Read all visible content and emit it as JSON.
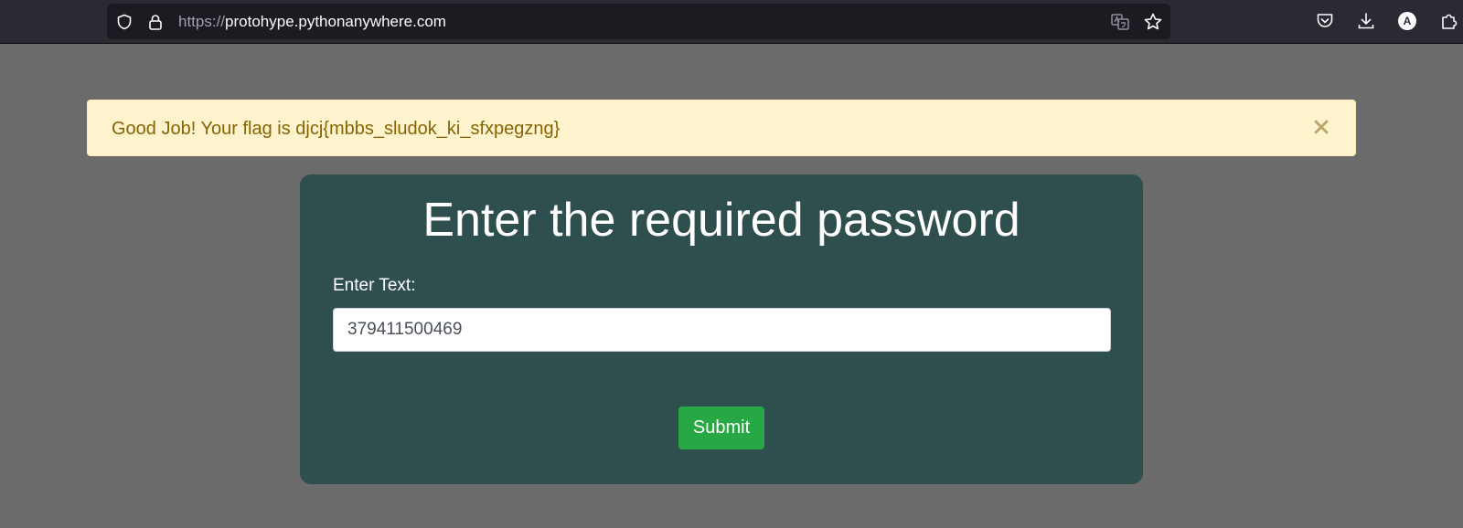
{
  "browser": {
    "url_scheme": "https://",
    "url_host": "protohype.pythonanywhere.com",
    "profile_initial": "A",
    "icons": [
      "shield-icon",
      "lock-icon",
      "translate-icon",
      "bookmark-star-icon",
      "pocket-icon",
      "download-icon",
      "extensions-icon"
    ]
  },
  "alert": {
    "message": "Good Job! Your flag is djcj{mbbs_sludok_ki_sfxpegzng}",
    "close_icon": "close-icon"
  },
  "form": {
    "title": "Enter the required password",
    "label": "Enter Text:",
    "input_value": "379411500469",
    "submit_label": "Submit"
  },
  "colors": {
    "page_background": "#6b6b6b",
    "card_background": "#2f4f4f",
    "alert_background": "#fff3cd",
    "alert_text": "#856404",
    "submit_button": "#28a745"
  }
}
